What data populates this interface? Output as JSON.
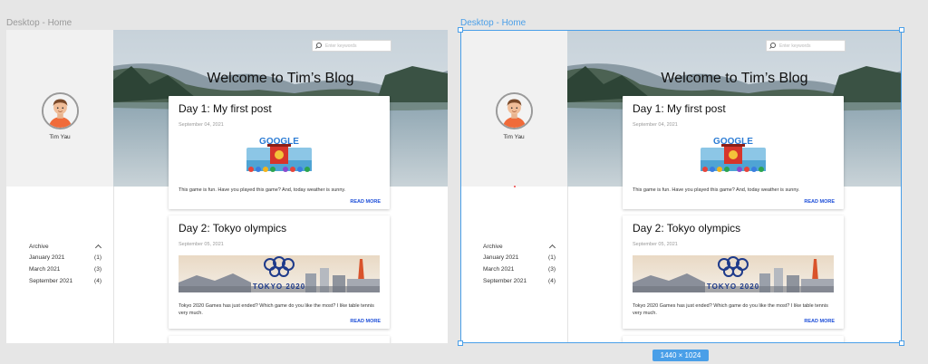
{
  "frames": [
    {
      "label": "Desktop - Home",
      "blog_title": "Welcome to Tim’s Blog",
      "search": {
        "placeholder": "Enter keywords"
      },
      "author": "Tim Yau",
      "archive": {
        "heading": "Archive",
        "items": [
          {
            "month": "January 2021",
            "count": "(1)"
          },
          {
            "month": "March 2021",
            "count": "(3)"
          },
          {
            "month": "September 2021",
            "count": "(4)"
          }
        ]
      },
      "posts": [
        {
          "title": "Day 1: My first post",
          "date": "September 04, 2021",
          "text": "This game is fun. Have you played this game? And, today weather is sunny.",
          "read_more": "READ MORE",
          "image_text": "GOOGLE"
        },
        {
          "title": "Day 2: Tokyo olympics",
          "date": "September 05, 2021",
          "text": "Tokyo 2020 Games has just ended? Which game do you like the most? I like table tennis very much.",
          "read_more": "READ MORE",
          "image_text": "TOKYO 2020"
        }
      ]
    },
    {
      "label": "Desktop - Home",
      "blog_title": "Welcome to Tim’s Blog",
      "search": {
        "placeholder": "Enter keywords"
      },
      "author": "Tim Yau",
      "archive": {
        "heading": "Archive",
        "items": [
          {
            "month": "January 2021",
            "count": "(1)"
          },
          {
            "month": "March 2021",
            "count": "(3)"
          },
          {
            "month": "September 2021",
            "count": "(4)"
          }
        ]
      },
      "posts": [
        {
          "title": "Day 1: My first post",
          "date": "September 04, 2021",
          "text": "This game is fun. Have you played this game? And, today weather is sunny.",
          "read_more": "READ MORE",
          "image_text": "GOOGLE"
        },
        {
          "title": "Day 2: Tokyo olympics",
          "date": "September 05, 2021",
          "text": "Tokyo 2020 Games has just ended? Which game do you like the most? I like table tennis very much.",
          "read_more": "READ MORE",
          "image_text": "TOKYO 2020"
        }
      ]
    }
  ],
  "selection": {
    "dimensions": "1440 × 1024"
  },
  "colors": {
    "accent": "#4a9fe8",
    "link": "#1d4ed8",
    "sidebar": "#f1f1f1",
    "canvas": "#e6e6e6"
  }
}
